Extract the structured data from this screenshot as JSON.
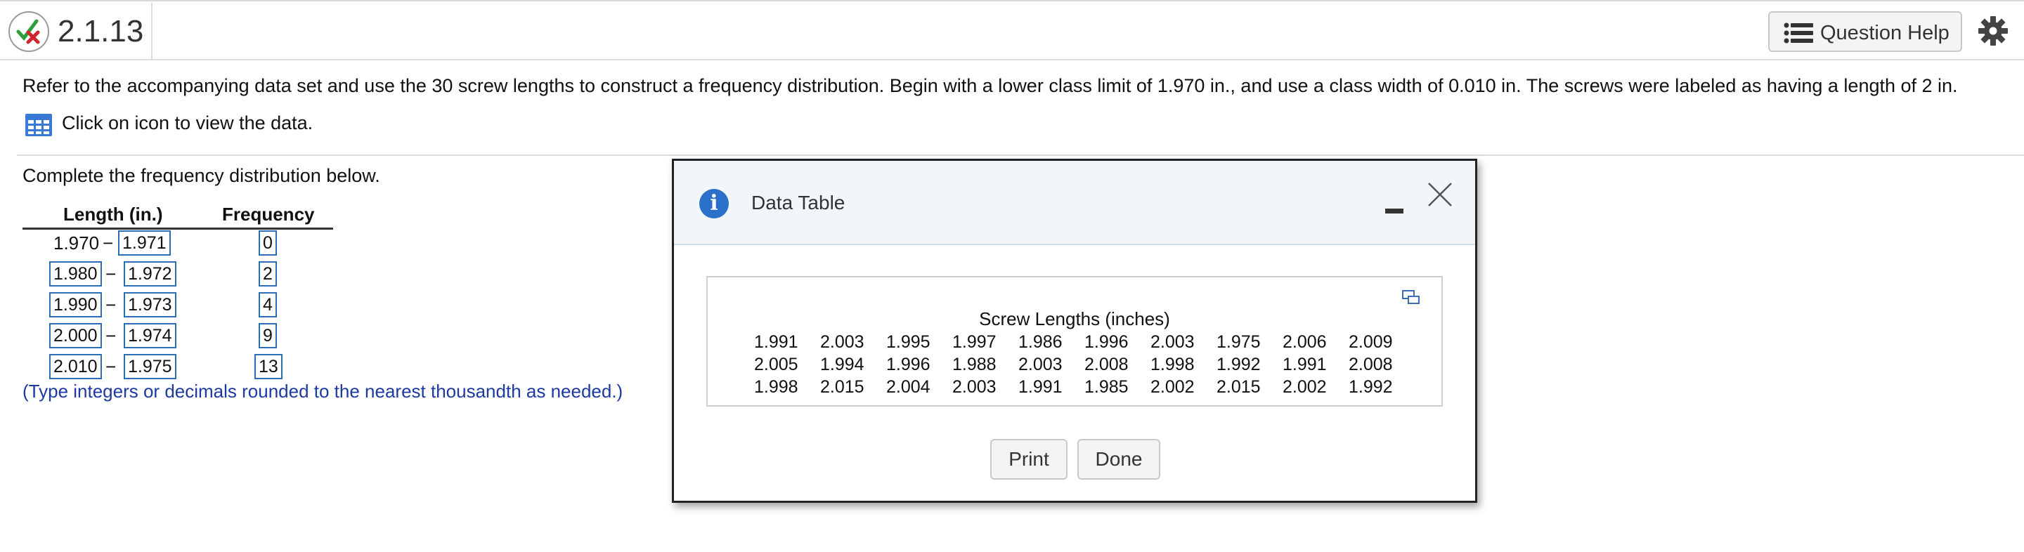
{
  "header": {
    "question_number": "2.1.13",
    "help_label": "Question Help"
  },
  "prompt": "Refer to the accompanying data set and use the 30 screw lengths to construct a frequency distribution. Begin with a lower class limit of 1.970 in., and use a class width of 0.010 in. The screws were labeled as having a length of 2 in.",
  "data_link": "Click on icon to view the data.",
  "instruction": "Complete the frequency distribution below.",
  "freq_table": {
    "col_length": "Length (in.)",
    "col_frequency": "Frequency",
    "first_lower": "1.970",
    "dash": "−",
    "rows": [
      {
        "lower": "1.970",
        "upper": "1.971",
        "frequency": "0"
      },
      {
        "lower": "1.980",
        "upper": "1.972",
        "frequency": "2"
      },
      {
        "lower": "1.990",
        "upper": "1.973",
        "frequency": "4"
      },
      {
        "lower": "2.000",
        "upper": "1.974",
        "frequency": "9"
      },
      {
        "lower": "2.010",
        "upper": "1.975",
        "frequency": "13"
      }
    ]
  },
  "hint": "(Type integers or decimals rounded to the nearest thousandth as needed.)",
  "dialog": {
    "title": "Data Table",
    "caption": "Screw Lengths (inches)",
    "rows": [
      [
        "1.991",
        "2.003",
        "1.995",
        "1.997",
        "1.986",
        "1.996",
        "2.003",
        "1.975",
        "2.006",
        "2.009"
      ],
      [
        "2.005",
        "1.994",
        "1.996",
        "1.988",
        "2.003",
        "2.008",
        "1.998",
        "1.992",
        "1.991",
        "2.008"
      ],
      [
        "1.998",
        "2.015",
        "2.004",
        "2.003",
        "1.991",
        "1.985",
        "2.002",
        "2.015",
        "2.002",
        "1.992"
      ]
    ],
    "print_label": "Print",
    "done_label": "Done"
  },
  "colors": {
    "accent_blue": "#2a6fc9",
    "input_border": "#2a6fb5",
    "hint_text": "#1d3aa3",
    "dialog_header_bg": "#f1f6fb"
  }
}
